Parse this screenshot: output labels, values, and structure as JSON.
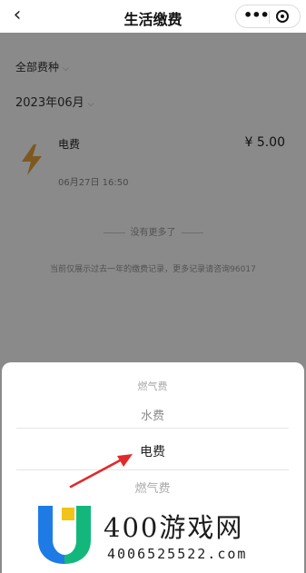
{
  "navbar": {
    "back_icon": "chevron-left-icon",
    "back_glyph": "‹",
    "title": "生活缴费",
    "more_glyph": "•••",
    "more_icon": "more-dots-icon",
    "close_icon": "target-icon"
  },
  "filters": {
    "fee_type": "全部费种",
    "month": "2023年06月",
    "chevron_glyph": "⌵"
  },
  "record": {
    "icon": "lightning-bolt-icon",
    "icon_color": "#E8A53C",
    "name": "电费",
    "amount": "¥ 5.00",
    "time": "06月27日 16:50"
  },
  "list_end": "没有更多了",
  "history_note": "当前仅展示过去一年的缴费记录，更多记录请咨询96017",
  "picker": {
    "options": [
      "水费",
      "电费",
      "燃气费"
    ],
    "selected": "电费"
  },
  "annotation": {
    "arrow_color": "#e02a2a"
  },
  "watermark": {
    "brand": "400游戏网",
    "url": "4006525522.com",
    "logo_colors": [
      "#1e7be6",
      "#13b77c",
      "#f2c318"
    ]
  }
}
